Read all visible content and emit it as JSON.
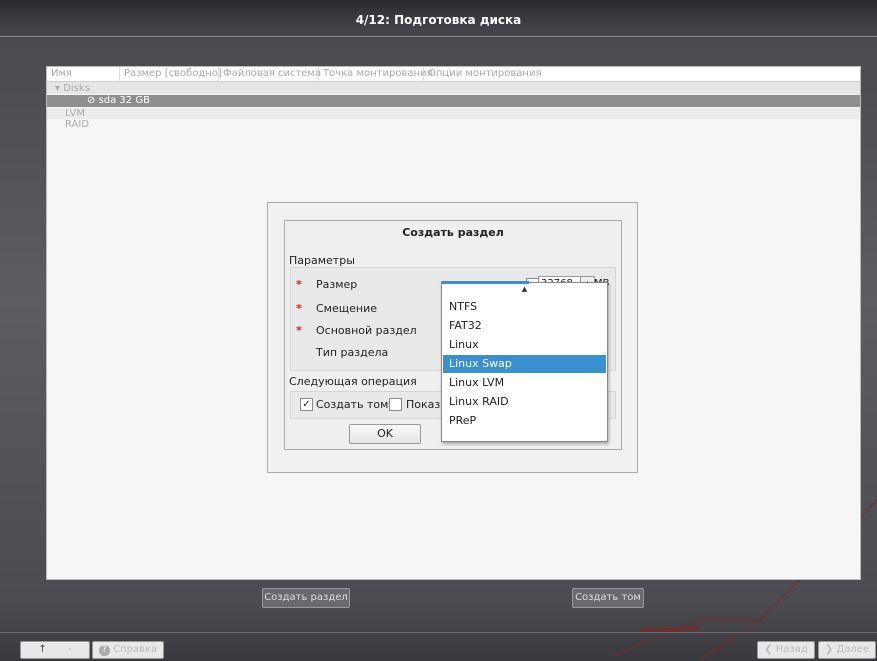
{
  "window": {
    "title": "4/12: Подготовка диска"
  },
  "table": {
    "columns": [
      "Имя",
      "Размер [свободно]",
      "Файловая система",
      "Точка монтирования",
      "Опции монтирования"
    ],
    "rows": [
      {
        "label": "Disks",
        "expander": "▾"
      },
      {
        "label": "sda  32 GB",
        "icon": "disk-icon",
        "selected": true
      },
      {
        "label": "LVM"
      },
      {
        "label": "RAID"
      }
    ]
  },
  "dialog": {
    "title": "Создать раздел",
    "params_label": "Параметры",
    "size_label": "Размер",
    "offset_label": "Смещение",
    "primary_label": "Основной раздел",
    "type_label": "Тип раздела",
    "size_value": "32768",
    "size_unit": "MB",
    "next_op_label": "Следующая операция",
    "create_volume_label": "Создать том",
    "create_volume_checked": "✓",
    "show_label": "Показь",
    "ok_label": "OK",
    "dropdown_up": "▲",
    "type_options": [
      "NTFS",
      "FAT32",
      "Linux",
      "Linux Swap",
      "Linux LVM",
      "Linux RAID",
      "PReP"
    ],
    "type_selected": "Linux Swap"
  },
  "actions": {
    "create_partition": "Создать раздел",
    "create_volume": "Создать том"
  },
  "footer": {
    "up": "↑",
    "dash": "-",
    "help": "Справка",
    "help_icon": "?",
    "back": "Назад",
    "back_icon": "❮",
    "next": "Далее",
    "next_icon": "❯"
  },
  "colors": {
    "accent": "#3a8fd0",
    "required": "#e02020"
  }
}
